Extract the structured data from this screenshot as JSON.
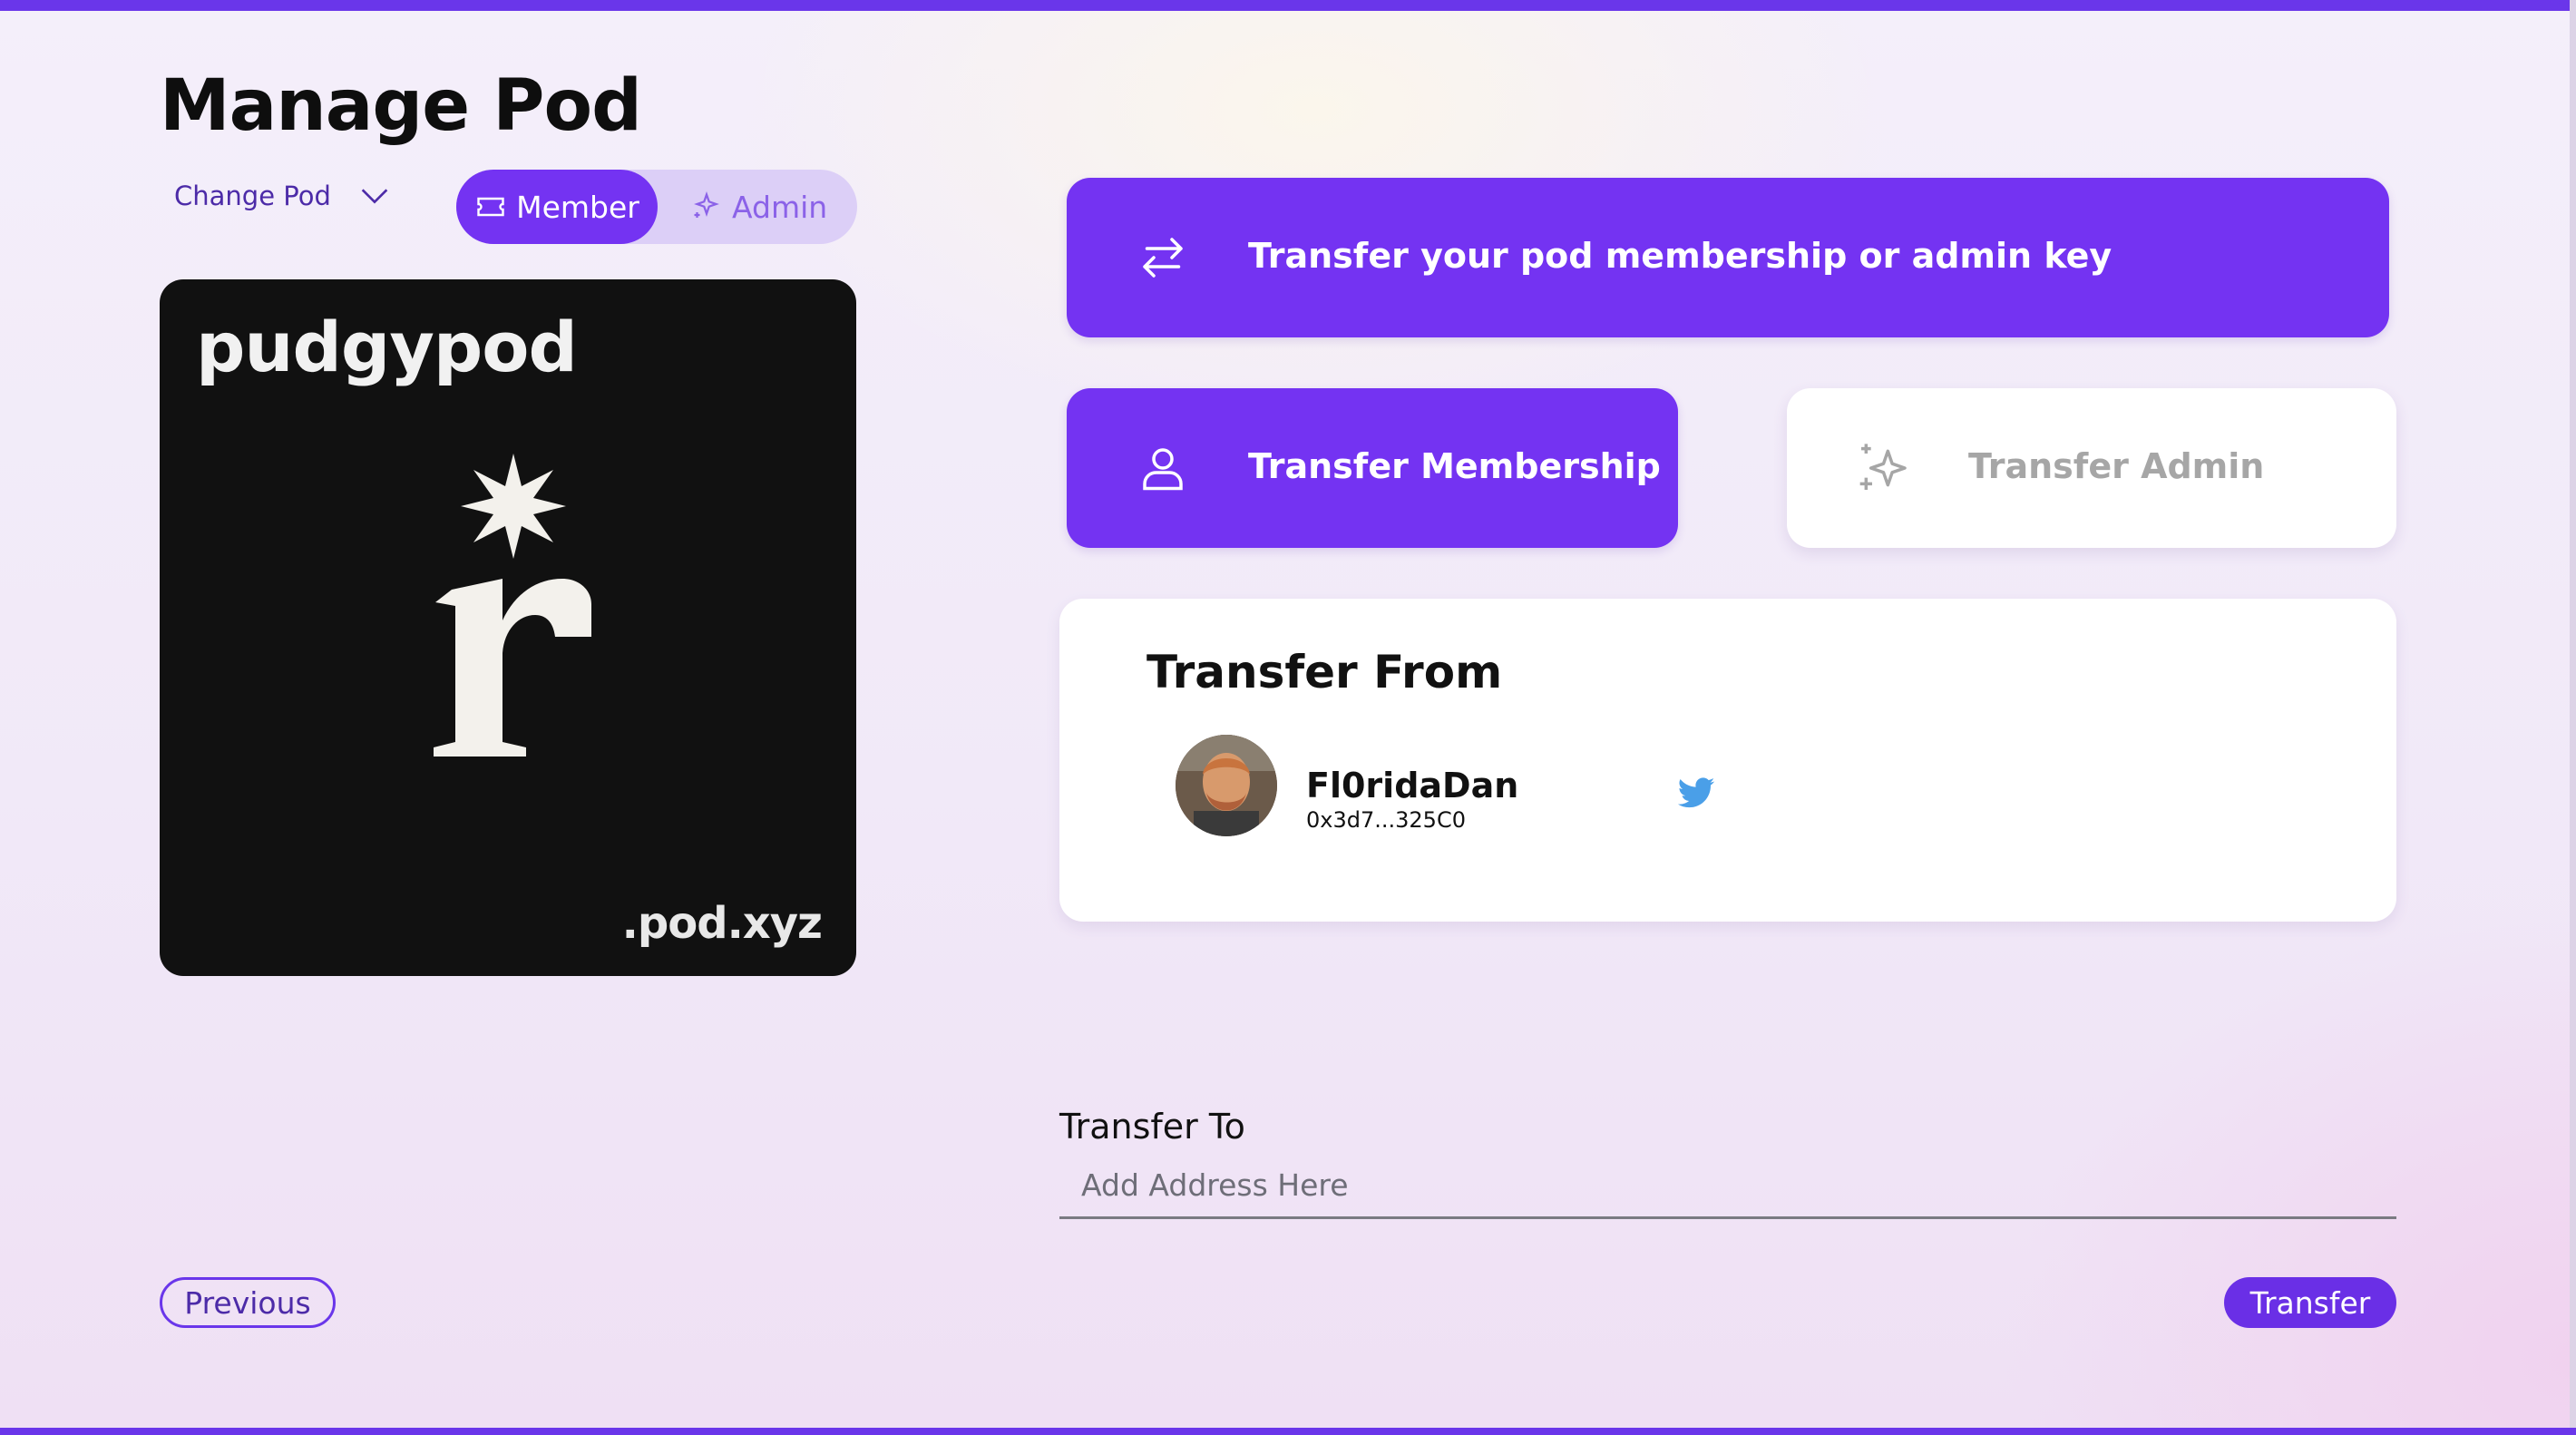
{
  "page": {
    "title": "Manage Pod"
  },
  "pod_switcher": {
    "label": "Change Pod",
    "icon": "chevron-down-icon"
  },
  "role_toggle": {
    "member_label": "Member",
    "admin_label": "Admin",
    "selected": "Member",
    "member_icon": "ticket-icon",
    "admin_icon": "sparkle-icon"
  },
  "pod": {
    "name": "pudgypod",
    "domain": ".pod.xyz",
    "logo": "star-r-logo"
  },
  "actions": {
    "transfer_key_label": "Transfer your pod membership or admin key",
    "transfer_membership_label": "Transfer Membership",
    "transfer_admin_label": "Transfer Admin",
    "transfer_key_icon": "arrows-swap-icon",
    "membership_icon": "user-icon",
    "admin_icon": "sparkles-icon"
  },
  "transfer_from": {
    "title": "Transfer From",
    "user": {
      "name": "Fl0ridaDan",
      "address": "0x3d7...325C0",
      "social_icon": "twitter-icon"
    }
  },
  "transfer_to": {
    "label": "Transfer To",
    "placeholder": "Add Address Here",
    "value": ""
  },
  "footer": {
    "previous_label": "Previous",
    "transfer_label": "Transfer"
  },
  "colors": {
    "accent": "#7433f2",
    "accent_light": "#dccff7",
    "card_dark": "#111111",
    "twitter": "#4a9fe8"
  }
}
